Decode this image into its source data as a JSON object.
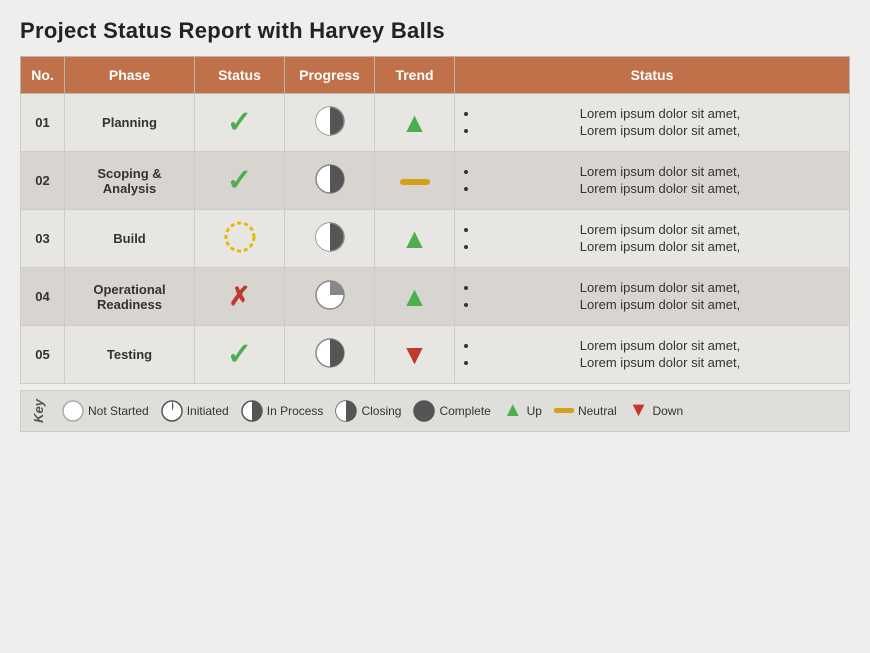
{
  "title": "Project Status Report with Harvey Balls",
  "header": {
    "cols": [
      "No.",
      "Phase",
      "Status",
      "Progress",
      "Trend",
      "Status"
    ]
  },
  "rows": [
    {
      "no": "01",
      "phase": "Planning",
      "status": "check",
      "progress": "closing",
      "trend": "up",
      "desc": [
        "Lorem ipsum dolor sit amet,",
        "Lorem ipsum dolor sit amet,"
      ]
    },
    {
      "no": "02",
      "phase": "Scoping & Analysis",
      "status": "check",
      "progress": "half",
      "trend": "neutral",
      "desc": [
        "Lorem ipsum dolor sit amet,",
        "Lorem ipsum dolor sit amet,"
      ]
    },
    {
      "no": "03",
      "phase": "Build",
      "status": "ring",
      "progress": "closing",
      "trend": "up",
      "desc": [
        "Lorem ipsum dolor sit amet,",
        "Lorem ipsum dolor sit amet,"
      ]
    },
    {
      "no": "04",
      "phase": "Operational Readiness",
      "status": "cross",
      "progress": "quarter",
      "trend": "up",
      "desc": [
        "Lorem ipsum dolor sit amet,",
        "Lorem ipsum dolor sit amet,"
      ]
    },
    {
      "no": "05",
      "phase": "Testing",
      "status": "check",
      "progress": "half",
      "trend": "down",
      "desc": [
        "Lorem ipsum dolor sit amet,",
        "Lorem ipsum dolor sit amet,"
      ]
    }
  ],
  "key": {
    "label": "Key",
    "items": [
      {
        "icon": "not-started",
        "text": "Not Started"
      },
      {
        "icon": "initiated",
        "text": "Initiated"
      },
      {
        "icon": "in-process",
        "text": "In Process"
      },
      {
        "icon": "closing",
        "text": "Closing"
      },
      {
        "icon": "complete",
        "text": "Complete"
      },
      {
        "icon": "up",
        "text": "Up"
      },
      {
        "icon": "neutral",
        "text": "Neutral"
      },
      {
        "icon": "down",
        "text": "Down"
      }
    ]
  }
}
